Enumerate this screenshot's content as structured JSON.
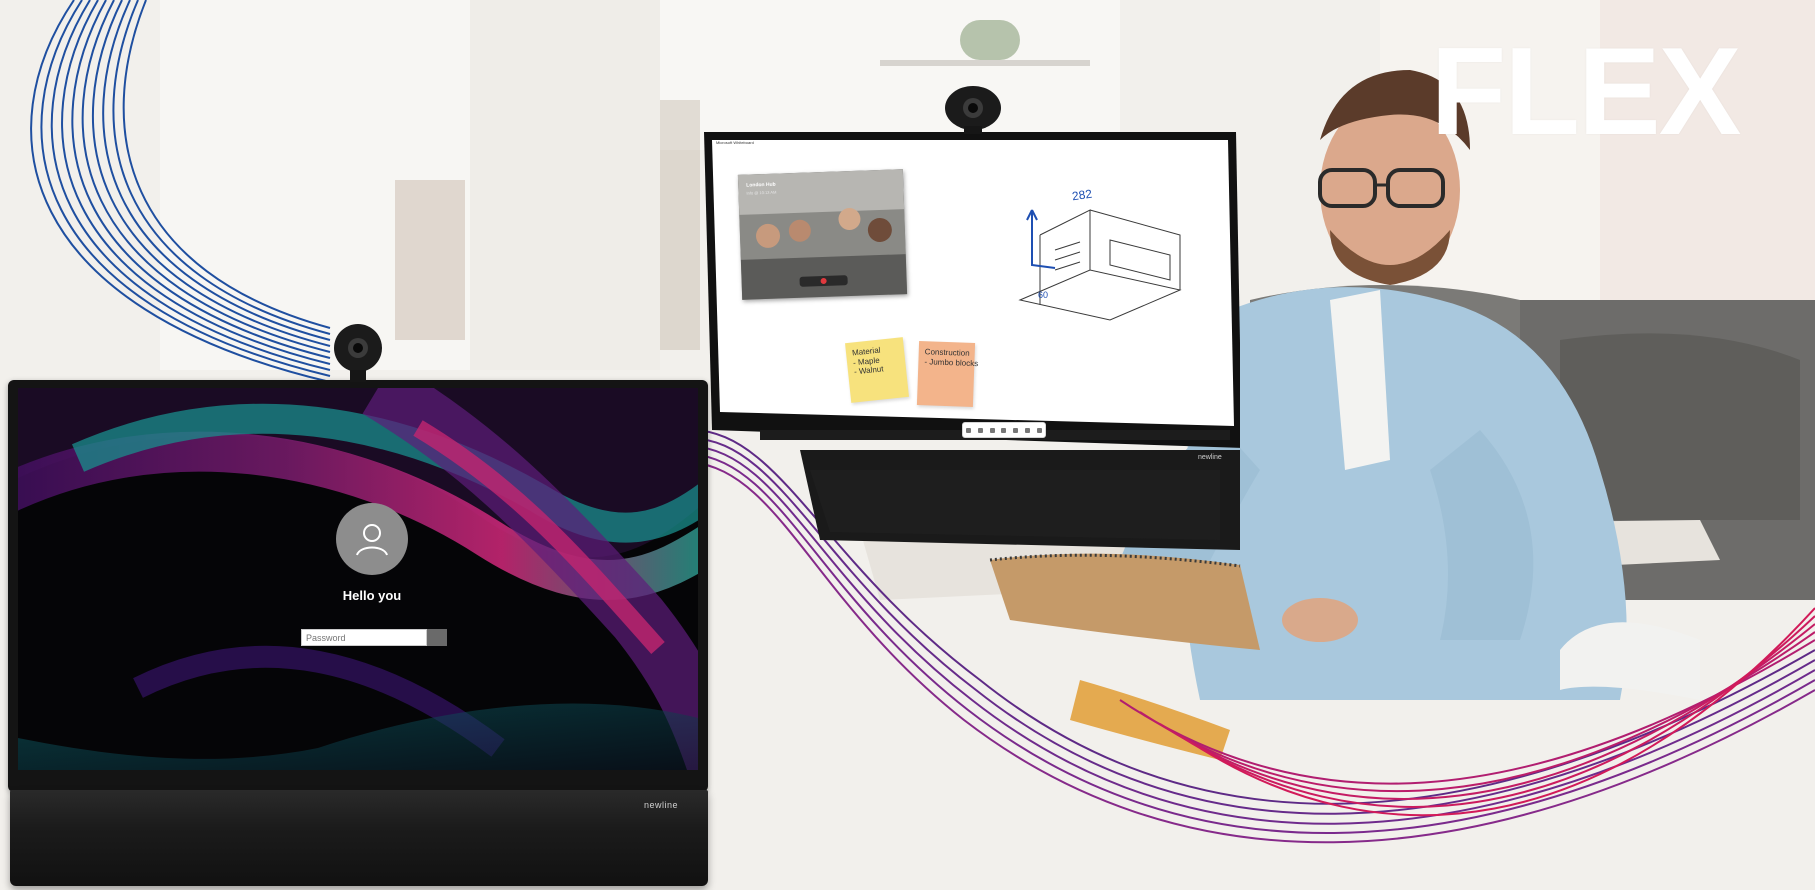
{
  "brand": {
    "title": "FLEX"
  },
  "left_monitor": {
    "greeting": "Hello you",
    "password_placeholder": "Password",
    "logo": "newline",
    "icons": {
      "avatar": "user-avatar-icon",
      "webcam": "webcam-icon"
    }
  },
  "right_monitor": {
    "window_title": "Microsoft Whiteboard",
    "video_call": {
      "title": "London Hub",
      "subtitle": "Info @ 10:13 AM"
    },
    "sticky_notes": [
      {
        "color": "#f7e27d",
        "lines": [
          "Material",
          "- Maple",
          "- Walnut"
        ]
      },
      {
        "color": "#f3b48b",
        "lines": [
          "Construction",
          "- Jumbo blocks"
        ]
      }
    ],
    "sketch_annotations": [
      "282",
      "60"
    ],
    "logo": "newline"
  },
  "colors": {
    "wave_blue": "#1f4fa0",
    "wave_purple": "#6b2c8f",
    "wave_magenta": "#c2185b",
    "brand_text": "#ffffff"
  }
}
